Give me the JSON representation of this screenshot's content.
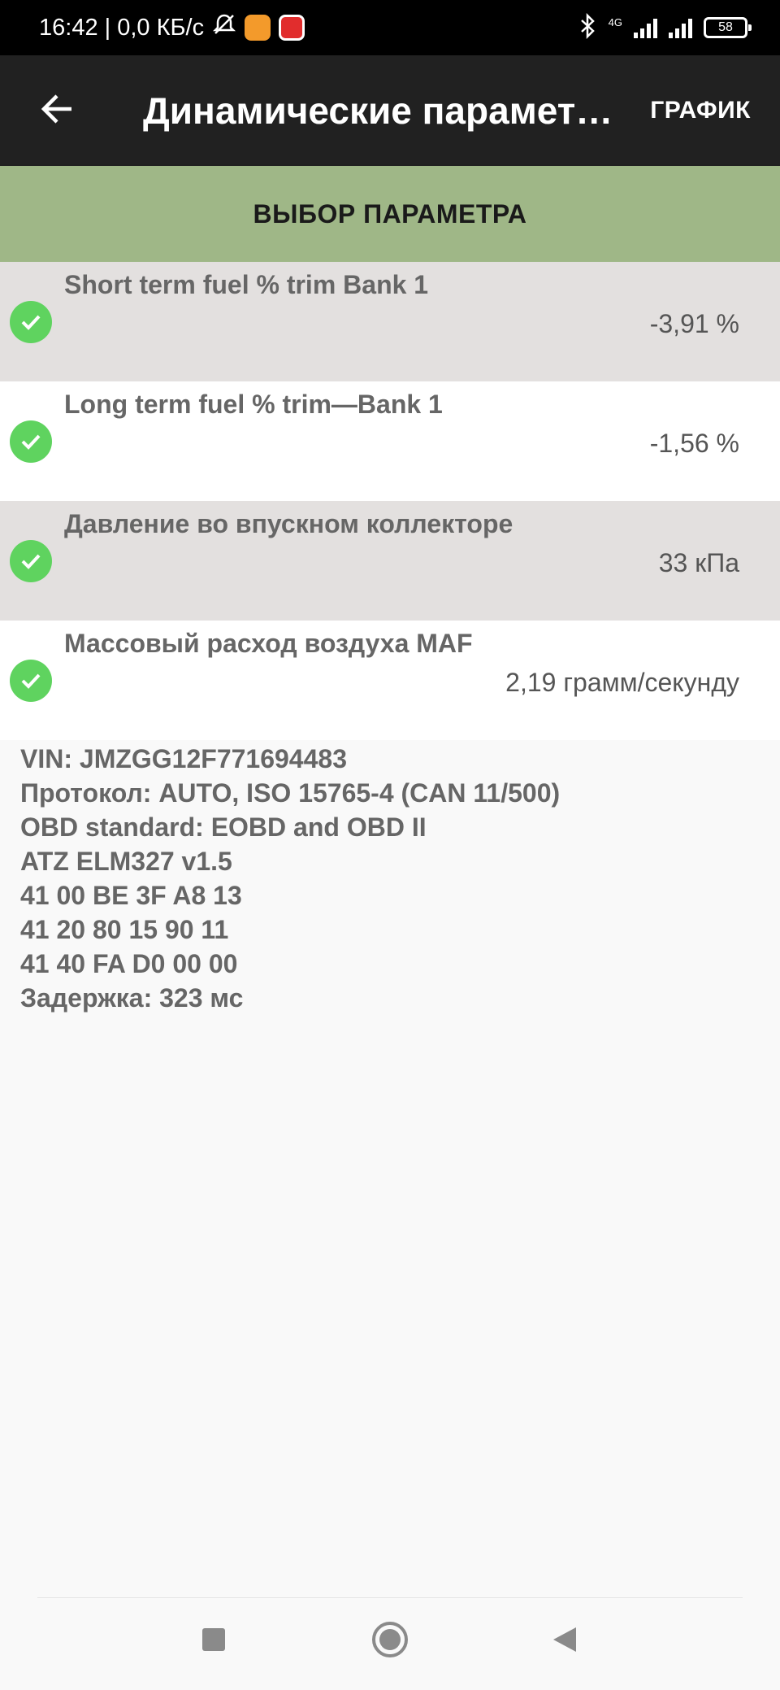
{
  "status_bar": {
    "time_speed": "16:42 | 0,0 КБ/с",
    "network_label": "4G",
    "battery": "58"
  },
  "toolbar": {
    "title": "Динамические параметры",
    "graph_label": "ГРАФИК"
  },
  "select_bar": {
    "label": "ВЫБОР ПАРАМЕТРА"
  },
  "parameters": [
    {
      "name": "Short term fuel % trim Bank 1",
      "value": "-3,91 %",
      "checked": true
    },
    {
      "name": "Long term fuel % trim—Bank 1",
      "value": "-1,56 %",
      "checked": true
    },
    {
      "name": "Давление во впускном коллекторе",
      "value": "33 кПа",
      "checked": true
    },
    {
      "name": "Массовый расход воздуха MAF",
      "value": "2,19 грамм/секунду",
      "checked": true
    }
  ],
  "info": {
    "vin": "VIN: JMZGG12F771694483",
    "protocol": "Протокол: AUTO, ISO 15765-4 (CAN 11/500)",
    "obd_standard": "OBD standard: EOBD and OBD II",
    "adapter": "ATZ ELM327 v1.5",
    "pid_00": "41 00 BE 3F A8 13",
    "pid_20": "41 20 80 15 90 11",
    "pid_40": "41 40 FA D0 00 00",
    "delay": "Задержка: 323 мс"
  },
  "icons": {
    "back": "arrow-left-icon",
    "check": "check-circle-icon",
    "nav_recent": "square-icon",
    "nav_home": "circle-icon",
    "nav_back": "triangle-left-icon"
  },
  "colors": {
    "toolbar": "#212121",
    "select_bar": "#9fb787",
    "check": "#5fd35f",
    "row_shaded": "#e3e0df"
  }
}
